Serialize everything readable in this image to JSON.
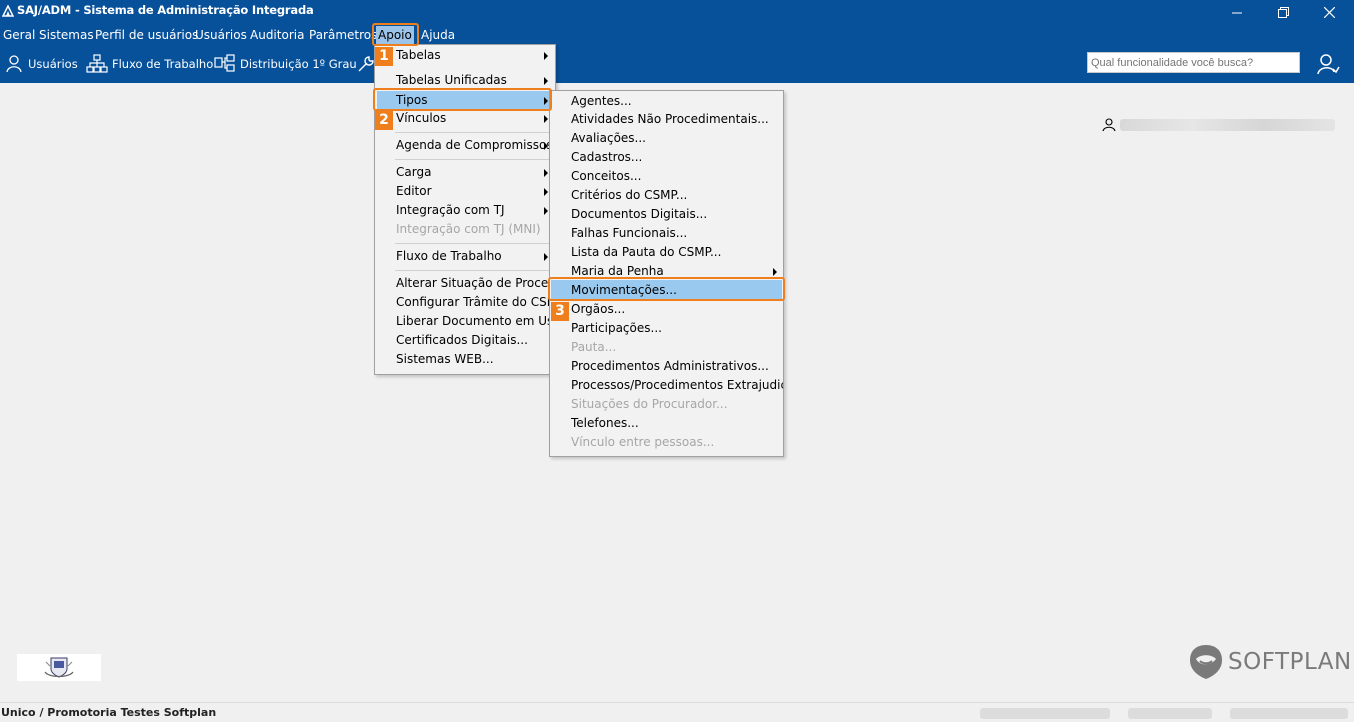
{
  "window": {
    "title": "SAJ/ADM - Sistema de Administração Integrada",
    "icons": [
      "app-icon",
      "minimize-icon",
      "restore-icon",
      "close-icon"
    ]
  },
  "menubar": {
    "items": [
      "Geral",
      "Sistemas",
      "Perfil de usuários",
      "Usuários",
      "Auditoria",
      "Parâmetros",
      "Apoio",
      "Ajuda"
    ],
    "active": "Apoio"
  },
  "toolbar": {
    "items": [
      {
        "label": "Usuários",
        "icon": "user-icon"
      },
      {
        "label": "Fluxo de Trabalho",
        "icon": "workflow-icon"
      },
      {
        "label": "Distribuição 1º Grau",
        "icon": "distribution-icon"
      }
    ],
    "search_placeholder": "Qual funcionalidade você busca?"
  },
  "apoio_menu": {
    "items": [
      {
        "label": "Tabelas",
        "submenu": true
      },
      {
        "label": "Tabelas Unificadas",
        "submenu": true
      },
      {
        "label": "Tipos",
        "submenu": true,
        "highlighted": true
      },
      {
        "label": "Vínculos",
        "submenu": true
      },
      {
        "label": "Agenda de Compromissos",
        "submenu": true
      },
      {
        "label": "Carga",
        "submenu": true
      },
      {
        "label": "Editor",
        "submenu": true
      },
      {
        "label": "Integração com TJ",
        "submenu": true
      },
      {
        "label": "Integração com TJ (MNI)",
        "submenu": false,
        "disabled": true
      },
      {
        "label": "Fluxo de Trabalho",
        "submenu": true
      },
      {
        "label": "Alterar Situação de Processos",
        "submenu": false
      },
      {
        "label": "Configurar Trâmite do CSMP",
        "submenu": false
      },
      {
        "label": "Liberar Documento em Uso...",
        "submenu": false
      },
      {
        "label": "Certificados Digitais...",
        "submenu": false
      },
      {
        "label": "Sistemas WEB...",
        "submenu": false
      }
    ]
  },
  "tipos_menu": {
    "items": [
      {
        "label": "Agentes..."
      },
      {
        "label": "Atividades Não Procedimentais..."
      },
      {
        "label": "Avaliações..."
      },
      {
        "label": "Cadastros..."
      },
      {
        "label": "Conceitos..."
      },
      {
        "label": "Critérios do CSMP..."
      },
      {
        "label": "Documentos Digitais..."
      },
      {
        "label": "Falhas Funcionais..."
      },
      {
        "label": "Lista da Pauta do CSMP..."
      },
      {
        "label": "Maria da Penha",
        "submenu": true
      },
      {
        "label": "Movimentações...",
        "highlighted": true
      },
      {
        "label": "Orgãos..."
      },
      {
        "label": "Participações..."
      },
      {
        "label": "Pauta...",
        "disabled": true
      },
      {
        "label": "Procedimentos Administrativos..."
      },
      {
        "label": "Processos/Procedimentos Extrajudiciais"
      },
      {
        "label": "Situações do Procurador...",
        "disabled": true
      },
      {
        "label": "Telefones..."
      },
      {
        "label": "Vínculo entre pessoas...",
        "disabled": true
      }
    ]
  },
  "callouts": [
    "1",
    "2",
    "3"
  ],
  "brand": {
    "name": "SOFTPLAN"
  },
  "status": {
    "organization": "Unico / Promotoria Testes Softplan"
  },
  "colors": {
    "chrome": "#07519b",
    "highlight": "#99c9ef",
    "callout": "#ee7f1c"
  }
}
